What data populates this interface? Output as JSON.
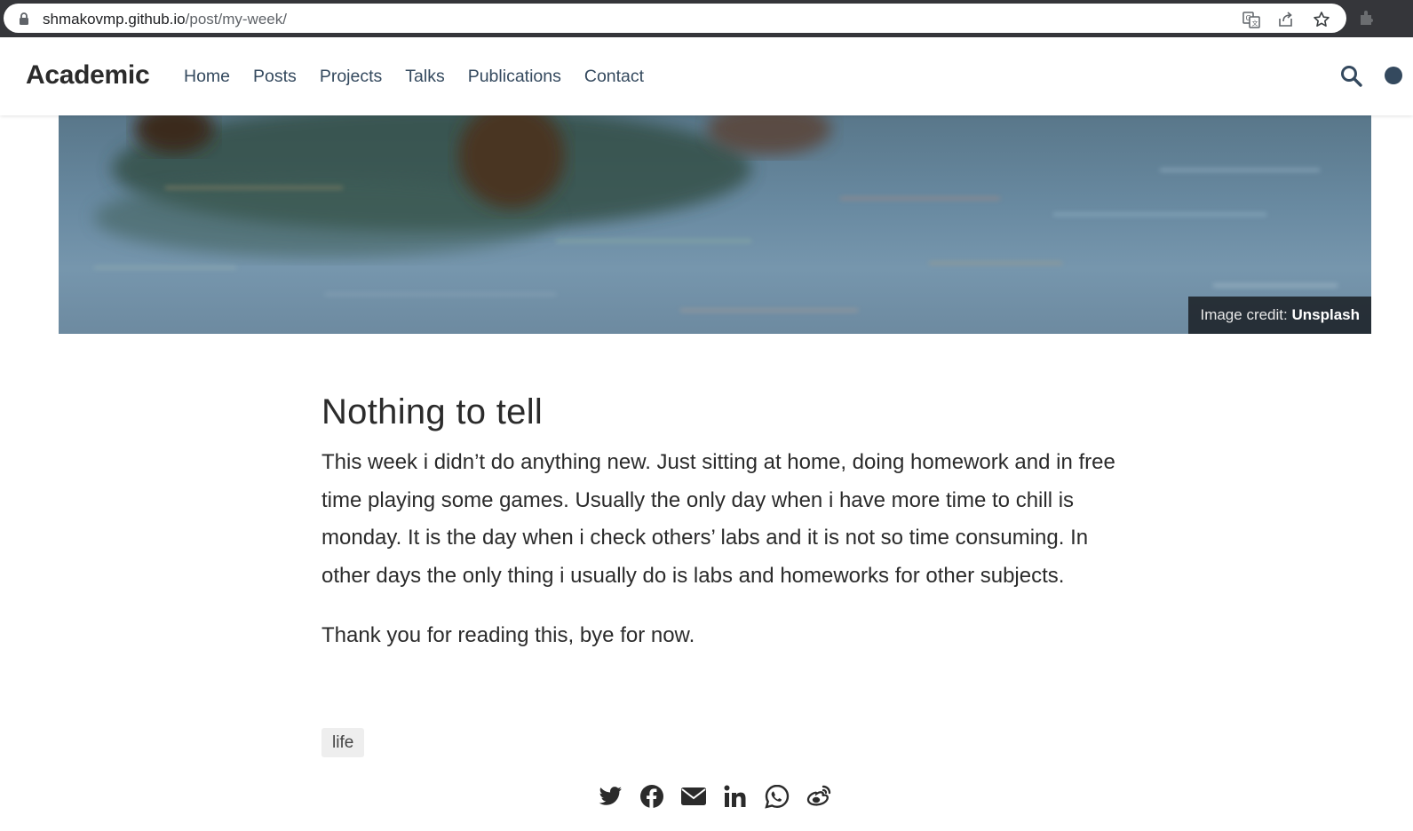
{
  "browser": {
    "url_host": "shmakovmp.github.io",
    "url_path": "/post/my-week/"
  },
  "navbar": {
    "brand": "Academic",
    "links": [
      "Home",
      "Posts",
      "Projects",
      "Talks",
      "Publications",
      "Contact"
    ]
  },
  "hero": {
    "credit_prefix": "Image credit: ",
    "credit_source": "Unsplash"
  },
  "article": {
    "title": "Nothing to tell",
    "paragraphs": [
      "This week i didn’t do anything new. Just sitting at home, doing homework and in free time playing some games. Usually the only day when i have more time to chill is monday. It is the day when i check others’ labs and it is not so time consuming. In other days the only thing i usually do is labs and homeworks for other subjects.",
      "Thank you for reading this, bye for now."
    ],
    "tags": [
      "life"
    ]
  },
  "share": {
    "icons": [
      "twitter-icon",
      "facebook-icon",
      "email-icon",
      "linkedin-icon",
      "whatsapp-icon",
      "weibo-icon"
    ]
  },
  "colors": {
    "nav_link": "#34495e",
    "text": "#2b2b2b",
    "browser_frame": "#35363a"
  }
}
